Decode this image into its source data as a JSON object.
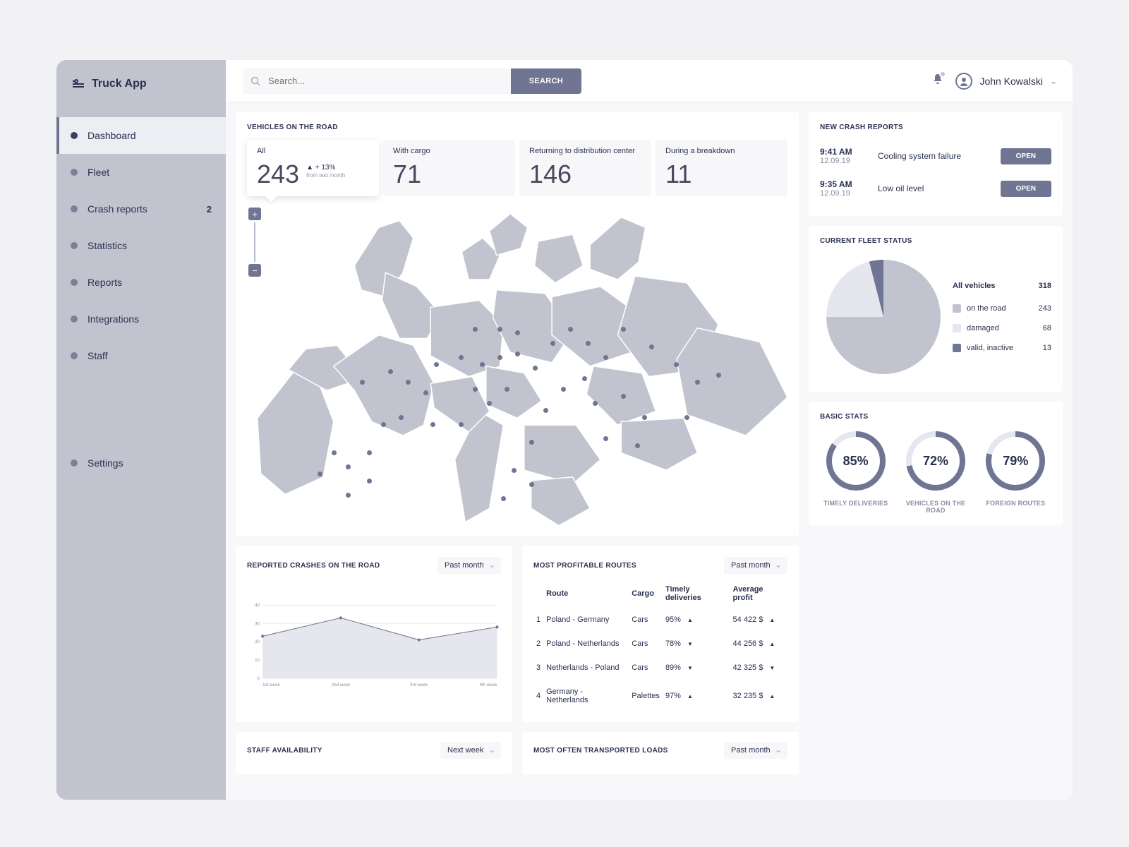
{
  "brand": "Truck App",
  "nav": [
    {
      "label": "Dashboard",
      "active": true
    },
    {
      "label": "Fleet"
    },
    {
      "label": "Crash reports",
      "badge": "2"
    },
    {
      "label": "Statistics"
    },
    {
      "label": "Reports"
    },
    {
      "label": "Integrations"
    },
    {
      "label": "Staff"
    }
  ],
  "settings_label": "Settings",
  "topbar": {
    "search_placeholder": "Search...",
    "search_btn": "SEARCH",
    "user": "John Kowalski"
  },
  "vehicles_card": {
    "title": "VEHICLES ON THE ROAD",
    "tiles": [
      {
        "label": "All",
        "value": "243",
        "trend": "▲ + 13%",
        "trend_sub": "from last month",
        "active": true
      },
      {
        "label": "With cargo",
        "value": "71"
      },
      {
        "label": "Returning to distribution center",
        "value": "146"
      },
      {
        "label": "During a breakdown",
        "value": "11"
      }
    ]
  },
  "crash_reports": {
    "title": "NEW CRASH REPORTS",
    "items": [
      {
        "time": "9:41 AM",
        "date": "12.09.19",
        "label": "Cooling system failure",
        "btn": "OPEN"
      },
      {
        "time": "9:35 AM",
        "date": "12.09.19",
        "label": "Low oil level",
        "btn": "OPEN"
      }
    ]
  },
  "fleet_status": {
    "title": "CURRENT FLEET STATUS",
    "header_label": "All vehicles",
    "header_value": "318",
    "rows": [
      {
        "label": "on the road",
        "value": "243",
        "color": "#c1c4ce"
      },
      {
        "label": "damaged",
        "value": "68",
        "color": "#e6e7ee"
      },
      {
        "label": "valid, inactive",
        "value": "13",
        "color": "#6f7592"
      }
    ]
  },
  "basic_stats": {
    "title": "BASIC STATS",
    "items": [
      {
        "pct": 85,
        "pct_label": "85%",
        "label": "TIMELY DELIVERIES"
      },
      {
        "pct": 72,
        "pct_label": "72%",
        "label": "VEHICLES ON THE ROAD"
      },
      {
        "pct": 79,
        "pct_label": "79%",
        "label": "FOREIGN ROUTES"
      }
    ]
  },
  "crashes_chart": {
    "title": "REPORTED CRASHES ON THE ROAD",
    "period": "Past month"
  },
  "routes": {
    "title": "MOST PROFITABLE ROUTES",
    "period": "Past month",
    "columns": [
      "",
      "Route",
      "Cargo",
      "Timely deliveries",
      "Average profit"
    ],
    "rows": [
      {
        "n": "1",
        "route": "Poland - Germany",
        "cargo": "Cars",
        "deliv": "95%",
        "dtrend": "up",
        "profit": "54 422 $",
        "ptrend": "up"
      },
      {
        "n": "2",
        "route": "Poland - Netherlands",
        "cargo": "Cars",
        "deliv": "78%",
        "dtrend": "down",
        "profit": "44 256 $",
        "ptrend": "up"
      },
      {
        "n": "3",
        "route": "Netherlands - Poland",
        "cargo": "Cars",
        "deliv": "89%",
        "dtrend": "down",
        "profit": "42 325 $",
        "ptrend": "down"
      },
      {
        "n": "4",
        "route": "Germany - Netherlands",
        "cargo": "Palettes",
        "deliv": "97%",
        "dtrend": "up",
        "profit": "32 235 $",
        "ptrend": "up"
      }
    ]
  },
  "staff_avail": {
    "title": "STAFF AVAILABILITY",
    "period": "Next week"
  },
  "most_loads": {
    "title": "MOST OFTEN TRANSPORTED LOADS",
    "period": "Past month"
  },
  "chart_data": {
    "type": "line",
    "title": "Reported crashes on the road",
    "categories": [
      "1st week",
      "2nd week",
      "3rd week",
      "4th week"
    ],
    "values": [
      23,
      33,
      21,
      28
    ],
    "ylabel": "",
    "ylim": [
      0,
      40
    ],
    "yticks": [
      0,
      10,
      20,
      30,
      40
    ]
  }
}
